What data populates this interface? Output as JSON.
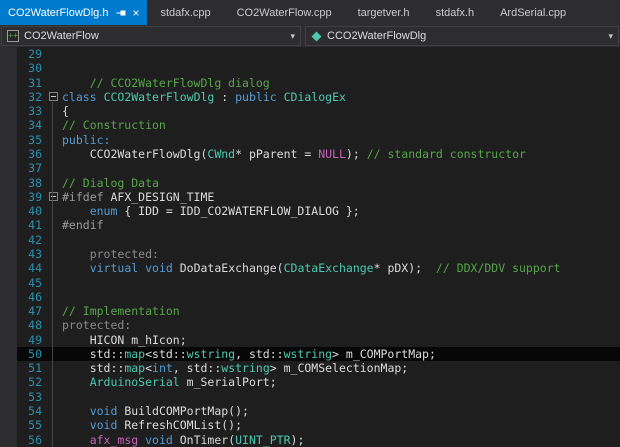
{
  "tabs": [
    {
      "label": "CO2WaterFlowDlg.h",
      "active": true
    },
    {
      "label": "stdafx.cpp",
      "active": false
    },
    {
      "label": "CO2WaterFlow.cpp",
      "active": false
    },
    {
      "label": "targetver.h",
      "active": false
    },
    {
      "label": "stdafx.h",
      "active": false
    },
    {
      "label": "ArdSerial.cpp",
      "active": false
    }
  ],
  "navbar": {
    "project": "CO2WaterFlow",
    "scope": "CCO2WaterFlowDlg"
  },
  "icons": {
    "close": "×",
    "chevron": "▾",
    "project_glyph": "++"
  },
  "editor": {
    "current_line": 50,
    "lines": [
      {
        "no": 29,
        "t": []
      },
      {
        "no": 30,
        "t": []
      },
      {
        "no": 31,
        "t": [
          [
            "cm",
            "    // CCO2WaterFlowDlg dialog"
          ]
        ]
      },
      {
        "no": 32,
        "fold": true,
        "t": [
          [
            "k",
            "class"
          ],
          [
            "d",
            " "
          ],
          [
            "ty",
            "CCO2WaterFlowDlg"
          ],
          [
            "d",
            " : "
          ],
          [
            "k",
            "public"
          ],
          [
            "d",
            " "
          ],
          [
            "ty",
            "CDialogEx"
          ]
        ]
      },
      {
        "no": 33,
        "t": [
          [
            "d",
            "{"
          ]
        ]
      },
      {
        "no": 34,
        "t": [
          [
            "cm",
            "// Construction"
          ]
        ]
      },
      {
        "no": 35,
        "t": [
          [
            "k",
            "public:"
          ]
        ]
      },
      {
        "no": 36,
        "t": [
          [
            "d",
            "    CCO2WaterFlowDlg("
          ],
          [
            "ty",
            "CWnd"
          ],
          [
            "d",
            "* pParent = "
          ],
          [
            "mc",
            "NULL"
          ],
          [
            "d",
            "); "
          ],
          [
            "cm",
            "// standard constructor"
          ]
        ]
      },
      {
        "no": 37,
        "t": []
      },
      {
        "no": 38,
        "t": [
          [
            "cm",
            "// Dialog Data"
          ]
        ]
      },
      {
        "no": 39,
        "fold": true,
        "t": [
          [
            "pp",
            "#ifdef "
          ],
          [
            "d",
            "AFX_DESIGN_TIME"
          ]
        ]
      },
      {
        "no": 40,
        "t": [
          [
            "d",
            "    "
          ],
          [
            "k",
            "enum"
          ],
          [
            "d",
            " { IDD = IDD_CO2WATERFLOW_DIALOG };"
          ]
        ]
      },
      {
        "no": 41,
        "t": [
          [
            "pp",
            "#endif"
          ]
        ]
      },
      {
        "no": 42,
        "t": []
      },
      {
        "no": 43,
        "t": [
          [
            "dim",
            "    protected:"
          ]
        ]
      },
      {
        "no": 44,
        "t": [
          [
            "d",
            "    "
          ],
          [
            "k",
            "virtual"
          ],
          [
            "d",
            " "
          ],
          [
            "k",
            "void"
          ],
          [
            "d",
            " DoDataExchange("
          ],
          [
            "ty",
            "CDataExchange"
          ],
          [
            "d",
            "* pDX);  "
          ],
          [
            "cm",
            "// DDX/DDV support"
          ]
        ]
      },
      {
        "no": 45,
        "t": []
      },
      {
        "no": 46,
        "t": []
      },
      {
        "no": 47,
        "t": [
          [
            "cm",
            "// Implementation"
          ]
        ]
      },
      {
        "no": 48,
        "t": [
          [
            "dim",
            "protected:"
          ]
        ]
      },
      {
        "no": 49,
        "t": [
          [
            "d",
            "    HICON m_hIcon;"
          ]
        ]
      },
      {
        "no": 50,
        "t": [
          [
            "d",
            "    std::"
          ],
          [
            "ty",
            "map"
          ],
          [
            "d",
            "<std::"
          ],
          [
            "ty",
            "wstring"
          ],
          [
            "d",
            ", std::"
          ],
          [
            "ty",
            "wstring"
          ],
          [
            "d",
            "> m_COMPortMap;"
          ]
        ]
      },
      {
        "no": 51,
        "t": [
          [
            "d",
            "    std::"
          ],
          [
            "ty",
            "map"
          ],
          [
            "d",
            "<"
          ],
          [
            "k",
            "int"
          ],
          [
            "d",
            ", std::"
          ],
          [
            "ty",
            "wstring"
          ],
          [
            "d",
            "> m_COMSelectionMap;"
          ]
        ]
      },
      {
        "no": 52,
        "t": [
          [
            "d",
            "    "
          ],
          [
            "ty",
            "ArduinoSerial"
          ],
          [
            "d",
            " m_SerialPort;"
          ]
        ]
      },
      {
        "no": 53,
        "t": []
      },
      {
        "no": 54,
        "t": [
          [
            "d",
            "    "
          ],
          [
            "k",
            "void"
          ],
          [
            "d",
            " BuildCOMPortMap();"
          ]
        ]
      },
      {
        "no": 55,
        "t": [
          [
            "d",
            "    "
          ],
          [
            "k",
            "void"
          ],
          [
            "d",
            " RefreshCOMList();"
          ]
        ]
      },
      {
        "no": 56,
        "t": [
          [
            "d",
            "    "
          ],
          [
            "mc",
            "afx_msg"
          ],
          [
            "d",
            " "
          ],
          [
            "k",
            "void"
          ],
          [
            "d",
            " OnTimer("
          ],
          [
            "ty",
            "UINT_PTR"
          ],
          [
            "d",
            ");"
          ]
        ]
      }
    ]
  },
  "colors": {
    "accent_blue": "#007ACC",
    "editor_bg": "#1E1E1E",
    "chrome_bg": "#2D2D30",
    "comment_green": "#57A64A",
    "keyword_blue": "#569CD6",
    "type_teal": "#4EC9B0",
    "macro_purple": "#C563BD",
    "preprocessor_gray": "#9B9B9B",
    "line_number_blue": "#2B91AF",
    "default_text": "#DCDCDC"
  }
}
